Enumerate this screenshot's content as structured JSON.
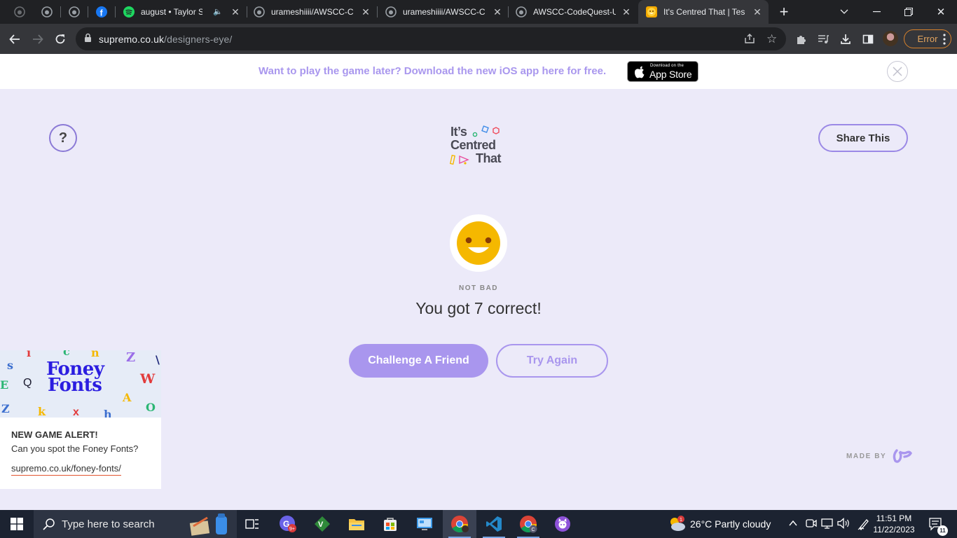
{
  "browser": {
    "tabs": [
      {
        "title": "",
        "pinned": true
      },
      {
        "title": "",
        "pinned": true
      },
      {
        "title": "",
        "pinned": true
      },
      {
        "title": "",
        "pinned": true
      },
      {
        "title": "august • Taylor Sw",
        "icon": "spotify-icon"
      },
      {
        "title": "urameshiiii/AWSCC-Co",
        "icon": "github-icon"
      },
      {
        "title": "urameshiiii/AWSCC-Co",
        "icon": "github-icon"
      },
      {
        "title": "AWSCC-CodeQuest-U",
        "icon": "github-icon"
      },
      {
        "title": "It's Centred That | Test",
        "icon": "smiley-icon",
        "active": true
      }
    ],
    "url_host": "supremo.co.uk",
    "url_path": "/designers-eye/",
    "profile_status": "Error"
  },
  "banner": {
    "text": "Want to play the game later? Download the new iOS app here for free.",
    "appstore_small": "Download on the",
    "appstore_big": "App Store"
  },
  "page": {
    "help_label": "?",
    "share_label": "Share This",
    "logo_line1": "It’s",
    "logo_line2": "Centred",
    "logo_line3": "That",
    "rating_label": "NOT BAD",
    "score_text": "You got 7 correct!",
    "challenge_label": "Challenge A Friend",
    "try_again_label": "Try Again",
    "made_by_label": "MADE BY"
  },
  "ad": {
    "image_title_1": "Foney",
    "image_title_2": "Fonts",
    "title": "NEW GAME ALERT!",
    "description": "Can you spot the Foney Fonts?",
    "link": "supremo.co.uk/foney-fonts/"
  },
  "taskbar": {
    "search_placeholder": "Type here to search",
    "weather": "26°C  Partly cloudy",
    "time": "11:51 PM",
    "date": "11/22/2023",
    "notification_count": "11"
  },
  "colors": {
    "accent": "#a996ee",
    "page_bg": "#eceaf9",
    "smiley": "#f5b800"
  }
}
